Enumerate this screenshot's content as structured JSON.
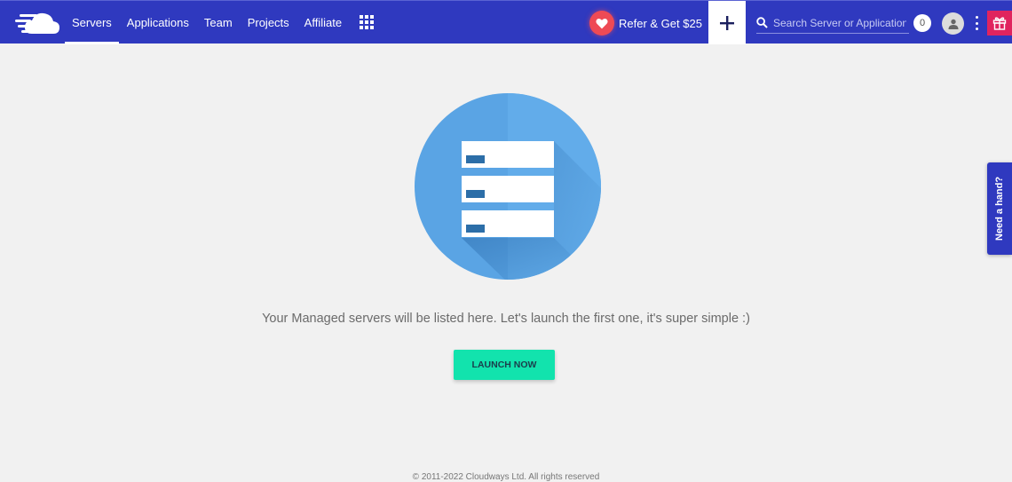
{
  "header": {
    "logo_name": "cloudways-logo",
    "nav": [
      {
        "label": "Servers",
        "active": true
      },
      {
        "label": "Applications",
        "active": false
      },
      {
        "label": "Team",
        "active": false
      },
      {
        "label": "Projects",
        "active": false
      },
      {
        "label": "Affiliate",
        "active": false
      }
    ],
    "apps_icon": "grid-icon",
    "refer_label": "Refer & Get $25",
    "add_icon": "plus-icon",
    "search": {
      "placeholder": "Search Server or Application",
      "value": ""
    },
    "notification_count": "0",
    "gift_icon": "gift-icon"
  },
  "main": {
    "empty_message": "Your Managed servers will be listed here. Let's launch the first one, it's super simple :)",
    "launch_button": "LAUNCH NOW",
    "colors": {
      "circle": "#5aa4e4",
      "accent_button": "#12e3ad",
      "brand": "#2f39bf"
    }
  },
  "help_tab": "Need a hand?",
  "footer": {
    "copyright": "© 2011-2022 Cloudways Ltd. All rights reserved"
  }
}
